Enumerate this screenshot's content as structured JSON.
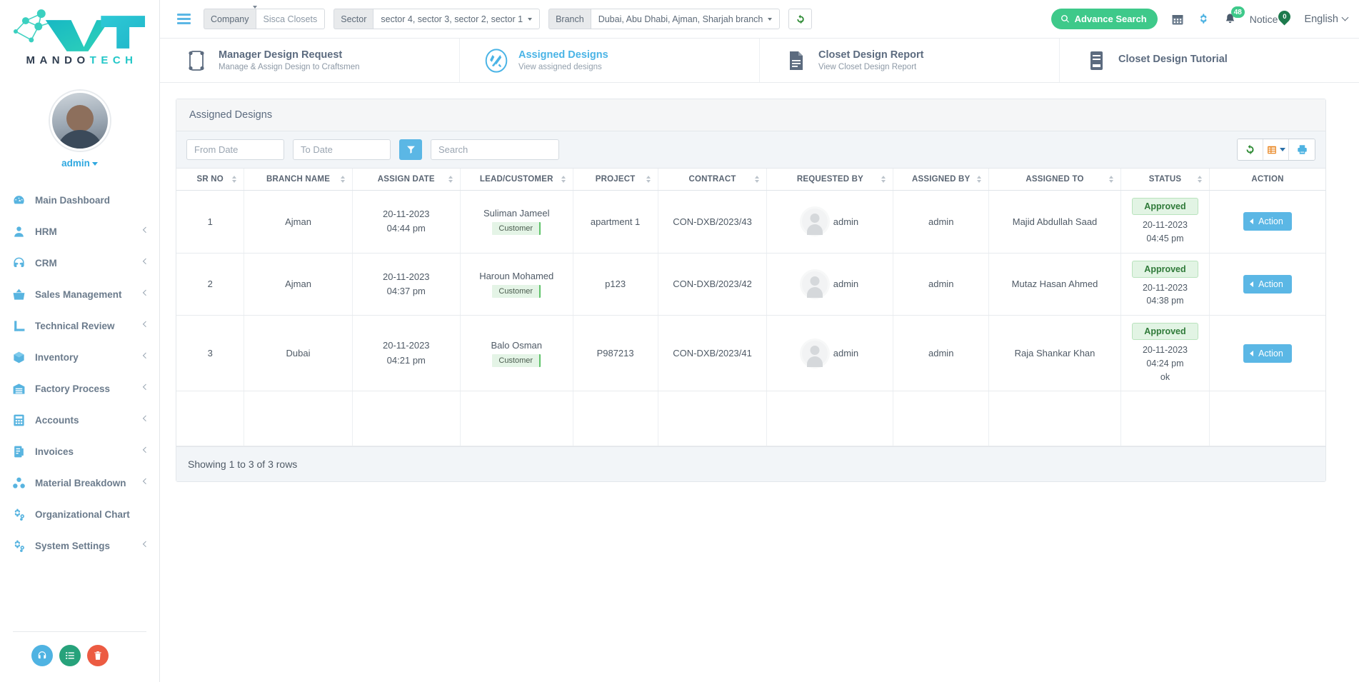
{
  "brand": {
    "name_top": "ViT",
    "name_bottom_1": "MANDO",
    "name_bottom_2": "TECH"
  },
  "profile": {
    "name": "admin"
  },
  "sidebar": {
    "items": [
      {
        "label": "Main Dashboard",
        "icon": "dashboard-icon",
        "chevron": false
      },
      {
        "label": "HRM",
        "icon": "user-icon",
        "chevron": true
      },
      {
        "label": "CRM",
        "icon": "headset-icon",
        "chevron": true
      },
      {
        "label": "Sales Management",
        "icon": "basket-icon",
        "chevron": true
      },
      {
        "label": "Technical Review",
        "icon": "ruler-icon",
        "chevron": true
      },
      {
        "label": "Inventory",
        "icon": "box-icon",
        "chevron": true
      },
      {
        "label": "Factory Process",
        "icon": "factory-icon",
        "chevron": true
      },
      {
        "label": "Accounts",
        "icon": "calculator-icon",
        "chevron": true
      },
      {
        "label": "Invoices",
        "icon": "invoice-icon",
        "chevron": true
      },
      {
        "label": "Material Breakdown",
        "icon": "molecule-icon",
        "chevron": true
      },
      {
        "label": "Organizational Chart",
        "icon": "cogs-icon",
        "chevron": false
      },
      {
        "label": "System Settings",
        "icon": "cogs-icon",
        "chevron": true
      }
    ],
    "fabs": [
      {
        "name": "support-fab",
        "icon": "headset-icon",
        "color": "#4fb3e2"
      },
      {
        "name": "tasks-fab",
        "icon": "list-icon",
        "color": "#27a27b"
      },
      {
        "name": "trash-fab",
        "icon": "trash-icon",
        "color": "#ec5b42"
      }
    ]
  },
  "topbar": {
    "company": {
      "label": "Company",
      "value": "Sisca Closets"
    },
    "sector": {
      "label": "Sector",
      "value": "sector 4, sector 3, sector 2, sector 1"
    },
    "branch": {
      "label": "Branch",
      "value": "Dubai, Abu Dhabi, Ajman, Sharjah branch"
    },
    "refresh_icon": "refresh-icon",
    "advance_search": "Advance Search",
    "calendar_icon": "calendar-icon",
    "settings_icon": "gear-icon",
    "bell_icon": "bell-icon",
    "bell_count": "48",
    "notice_label": "Notice",
    "notice_count": "0",
    "language": "English"
  },
  "modules": [
    {
      "title": "Manager Design Request",
      "subtitle": "Manage & Assign Design to Craftsmen",
      "icon": "design-frame-icon",
      "active": false
    },
    {
      "title": "Assigned Designs",
      "subtitle": "View assigned designs",
      "icon": "tools-circle-icon",
      "active": true
    },
    {
      "title": "Closet Design Report",
      "subtitle": "View Closet Design Report",
      "icon": "report-doc-icon",
      "active": false
    },
    {
      "title": "Closet Design Tutorial",
      "subtitle": "",
      "icon": "tutorial-doc-icon",
      "active": false
    }
  ],
  "card": {
    "title": "Assigned Designs",
    "toolbar": {
      "from_date_placeholder": "From Date",
      "to_date_placeholder": "To Date",
      "filter_icon": "funnel-icon",
      "search_placeholder": "Search",
      "refresh_icon": "refresh-icon",
      "columns_icon": "columns-icon",
      "print_icon": "print-icon"
    },
    "columns": [
      "SR NO",
      "BRANCH NAME",
      "ASSIGN DATE",
      "LEAD/CUSTOMER",
      "PROJECT",
      "CONTRACT",
      "REQUESTED BY",
      "ASSIGNED BY",
      "ASSIGNED TO",
      "STATUS",
      "ACTION"
    ],
    "rows": [
      {
        "sr_no": "1",
        "branch_name": "Ajman",
        "assign_date": "20-11-2023",
        "assign_time": "04:44 pm",
        "lead_customer": "Suliman Jameel",
        "lead_badge": "Customer",
        "project": "apartment 1",
        "contract": "CON-DXB/2023/43",
        "requested_by": "admin",
        "assigned_by": "admin",
        "assigned_to": "Majid Abdullah Saad",
        "status": "Approved",
        "status_date": "20-11-2023",
        "status_time": "04:45 pm",
        "status_note": "",
        "action_label": "Action"
      },
      {
        "sr_no": "2",
        "branch_name": "Ajman",
        "assign_date": "20-11-2023",
        "assign_time": "04:37 pm",
        "lead_customer": "Haroun Mohamed",
        "lead_badge": "Customer",
        "project": "p123",
        "contract": "CON-DXB/2023/42",
        "requested_by": "admin",
        "assigned_by": "admin",
        "assigned_to": "Mutaz Hasan Ahmed",
        "status": "Approved",
        "status_date": "20-11-2023",
        "status_time": "04:38 pm",
        "status_note": "",
        "action_label": "Action"
      },
      {
        "sr_no": "3",
        "branch_name": "Dubai",
        "assign_date": "20-11-2023",
        "assign_time": "04:21 pm",
        "lead_customer": "Balo Osman",
        "lead_badge": "Customer",
        "project": "P987213",
        "contract": "CON-DXB/2023/41",
        "requested_by": "admin",
        "assigned_by": "admin",
        "assigned_to": "Raja Shankar Khan",
        "status": "Approved",
        "status_date": "20-11-2023",
        "status_time": "04:24 pm",
        "status_note": "ok",
        "action_label": "Action"
      }
    ],
    "footer": "Showing 1 to 3 of 3 rows"
  },
  "colors": {
    "accent_blue": "#5bb7e5",
    "accent_green": "#3ec98a",
    "status_green": "#2f7a39",
    "text_muted": "#6b7b8c"
  }
}
